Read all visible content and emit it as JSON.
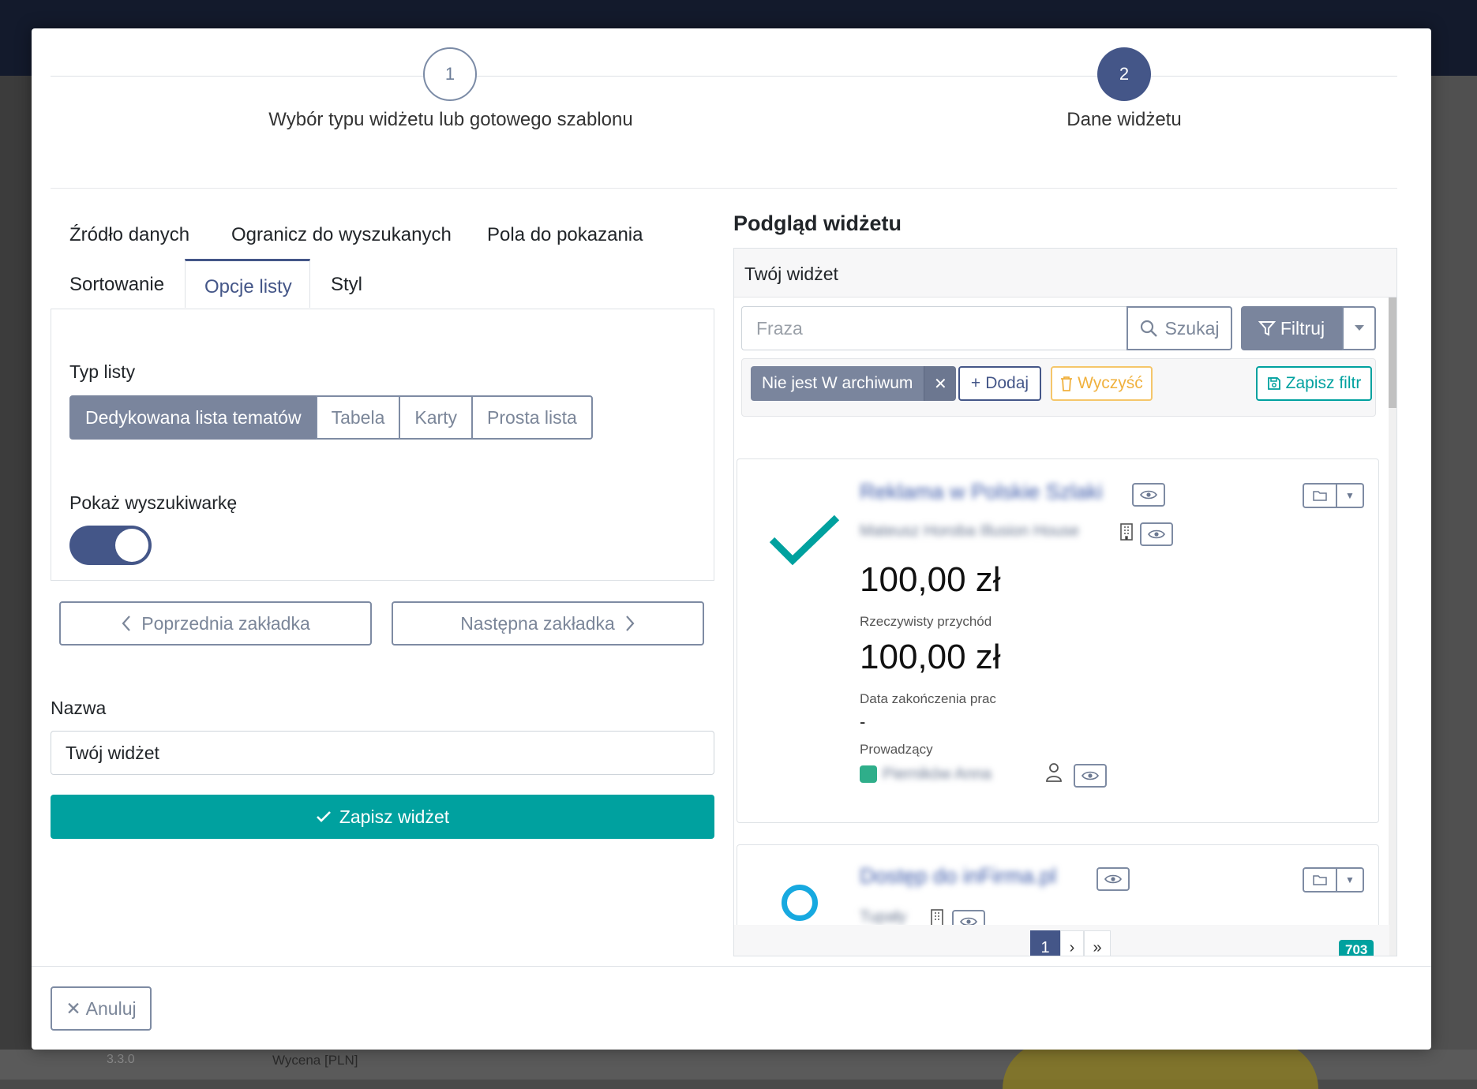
{
  "background": {
    "version": "3.3.0",
    "column_label": "Wycena [PLN]"
  },
  "stepper": {
    "steps": [
      {
        "number": "1",
        "label": "Wybór typu widżetu lub gotowego szablonu"
      },
      {
        "number": "2",
        "label": "Dane widżetu"
      }
    ],
    "active_step": 2
  },
  "tabs": {
    "items": [
      {
        "label": "Źródło danych"
      },
      {
        "label": "Ogranicz do wyszukanych"
      },
      {
        "label": "Pola do pokazania"
      },
      {
        "label": "Sortowanie"
      },
      {
        "label": "Opcje listy"
      },
      {
        "label": "Styl"
      }
    ],
    "active": "Opcje listy"
  },
  "list_options": {
    "list_type_label": "Typ listy",
    "list_types": [
      "Dedykowana lista tematów",
      "Tabela",
      "Karty",
      "Prosta lista"
    ],
    "selected_list_type": "Dedykowana lista tematów",
    "show_search_label": "Pokaż wyszukiwarkę",
    "show_search_enabled": true
  },
  "navigation": {
    "prev_label": "Poprzednia zakładka",
    "next_label": "Następna zakładka"
  },
  "name_field": {
    "label": "Nazwa",
    "value": "Twój widżet"
  },
  "save_label": "Zapisz widżet",
  "preview": {
    "title": "Podgląd widżetu",
    "widget_title": "Twój widżet",
    "search_placeholder": "Fraza",
    "search_button": "Szukaj",
    "filter_button": "Filtruj",
    "active_filter": "Nie jest W archiwum",
    "add_filter": "Dodaj",
    "clear_filter": "Wyczyść",
    "save_filter": "Zapisz filtr",
    "cards": [
      {
        "title": "Reklama w Polskie Szlaki",
        "subtitle": "Mateusz Horoba Illusion House",
        "amount1": "100,00 zł",
        "label1": "Rzeczywisty przychód",
        "amount2": "100,00 zł",
        "label2": "Data zakończenia prac",
        "value2": "-",
        "label3": "Prowadzący",
        "person": "Pierników Anna",
        "status": "done"
      },
      {
        "title": "Dostęp do inFirma.pl",
        "subtitle": "Tupały",
        "status": "open"
      }
    ],
    "pagination": {
      "current": "1",
      "next": "›",
      "last": "»",
      "total_count": "703"
    }
  },
  "cancel_label": "Anuluj",
  "colors": {
    "primary": "#445688",
    "accent": "#00a19f",
    "muted": "#7a859d",
    "warning": "#f0b13e"
  }
}
